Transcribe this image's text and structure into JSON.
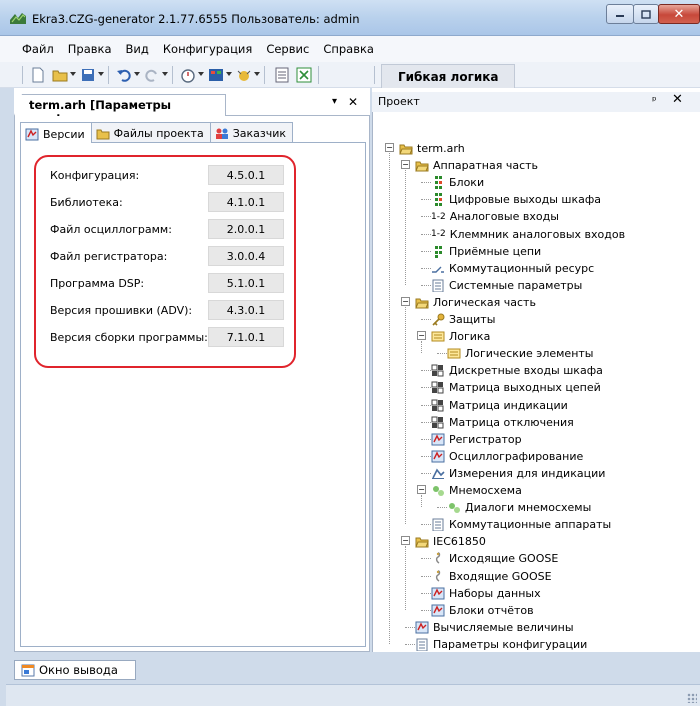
{
  "window": {
    "title": "Ekra3.CZG-generator 2.1.77.6555 Пользователь: admin",
    "close_glyph": "✕"
  },
  "menu": [
    "Файл",
    "Правка",
    "Вид",
    "Конфигурация",
    "Сервис",
    "Справка"
  ],
  "toolbar": {
    "flex_logic_tab": "Гибкая логика"
  },
  "document_tab": {
    "label": "term.arh [Параметры конфиг...",
    "pin_glyph": "▾",
    "close_glyph": "✕"
  },
  "subtabs": [
    {
      "label": "Версии",
      "active": true,
      "icon": "versions-icon"
    },
    {
      "label": "Файлы проекта",
      "active": false,
      "icon": "folder-icon"
    },
    {
      "label": "Заказчик",
      "active": false,
      "icon": "customer-icon"
    }
  ],
  "versions": [
    {
      "label": "Конфигурация:",
      "value": "4.5.0.1"
    },
    {
      "label": "Библиотека:",
      "value": "4.1.0.1"
    },
    {
      "label": "Файл осциллограмм:",
      "value": "2.0.0.1"
    },
    {
      "label": "Файл регистратора:",
      "value": "3.0.0.4"
    },
    {
      "label": "Программа DSP:",
      "value": "5.1.0.1"
    },
    {
      "label": "Версия прошивки (ADV):",
      "value": "4.3.0.1"
    },
    {
      "label": "Версия сборки программы:",
      "value": "7.1.0.1"
    }
  ],
  "project_panel": {
    "title": "Проект",
    "pin_glyph": "ᵖ",
    "close_glyph": "✕"
  },
  "tree": [
    {
      "label": "term.arh",
      "icon": "folder-open-icon"
    },
    {
      "label": "Аппаратная часть",
      "icon": "folder-open-icon"
    },
    {
      "label": "Блоки",
      "icon": "blocks-icon"
    },
    {
      "label": "Цифровые выходы шкафа",
      "icon": "blocks-icon"
    },
    {
      "label": "Аналоговые входы",
      "icon": "analog-icon",
      "glyph": "1-2"
    },
    {
      "label": "Клеммник аналоговых входов",
      "icon": "analog-icon",
      "glyph": "1-2"
    },
    {
      "label": "Приёмные цепи",
      "icon": "receive-icon"
    },
    {
      "label": "Коммутационный ресурс",
      "icon": "switch-resource-icon"
    },
    {
      "label": "Системные параметры",
      "icon": "system-params-icon"
    },
    {
      "label": "Логическая часть",
      "icon": "folder-open-icon"
    },
    {
      "label": "Защиты",
      "icon": "key-icon"
    },
    {
      "label": "Логика",
      "icon": "logic-icon"
    },
    {
      "label": "Логические элементы",
      "icon": "logic-icon"
    },
    {
      "label": "Дискретные входы шкафа",
      "icon": "matrix-icon"
    },
    {
      "label": "Матрица выходных цепей",
      "icon": "matrix-icon"
    },
    {
      "label": "Матрица индикации",
      "icon": "matrix-icon"
    },
    {
      "label": "Матрица отключения",
      "icon": "matrix-icon"
    },
    {
      "label": "Регистратор",
      "icon": "recorder-icon"
    },
    {
      "label": "Осциллографирование",
      "icon": "recorder-icon"
    },
    {
      "label": "Измерения для индикации",
      "icon": "measure-icon"
    },
    {
      "label": "Мнемосхема",
      "icon": "mnemo-icon"
    },
    {
      "label": "Диалоги мнемосхемы",
      "icon": "mnemo-icon"
    },
    {
      "label": "Коммутационные аппараты",
      "icon": "system-params-icon"
    },
    {
      "label": "IEC61850",
      "icon": "folder-open-icon"
    },
    {
      "label": "Исходящие GOOSE",
      "icon": "goose-icon"
    },
    {
      "label": "Входящие GOOSE",
      "icon": "goose-icon"
    },
    {
      "label": "Наборы данных",
      "icon": "recorder-icon"
    },
    {
      "label": "Блоки отчётов",
      "icon": "recorder-icon"
    },
    {
      "label": "Вычисляемые величины",
      "icon": "recorder-icon"
    },
    {
      "label": "Параметры конфигурации",
      "icon": "system-params-icon"
    }
  ],
  "output_tab": {
    "label": "Окно вывода"
  },
  "colors": {
    "highlight_frame": "#e0242c",
    "folder": "#e8c04a"
  }
}
